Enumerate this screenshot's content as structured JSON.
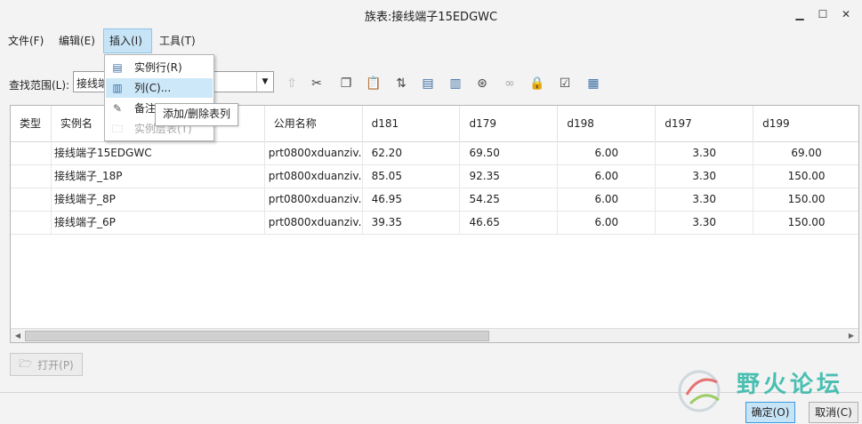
{
  "window": {
    "title": "族表:接线端子15EDGWC"
  },
  "menus": [
    {
      "label": "文件(F)"
    },
    {
      "label": "编辑(E)"
    },
    {
      "label": "插入(I)"
    },
    {
      "label": "工具(T)"
    }
  ],
  "insert_menu": {
    "items": [
      {
        "label": "实例行(R)",
        "icon": "instance-row-icon"
      },
      {
        "label": "列(C)...",
        "icon": "column-icon"
      },
      {
        "label": "备注",
        "icon": "note-icon"
      },
      {
        "label": "实例层表(T)",
        "icon": "folder-icon"
      }
    ],
    "tooltip": "添加/删除表列"
  },
  "search": {
    "label": "查找范围(L):",
    "value": "接线端"
  },
  "table": {
    "headers": [
      "类型",
      "实例名",
      "公用名称",
      "d181",
      "d179",
      "d198",
      "d197",
      "d199"
    ],
    "rows": [
      [
        "",
        "接线端子15EDGWC",
        "prt0800xduanziv...",
        "62.20",
        "69.50",
        "6.00",
        "3.30",
        "69.00"
      ],
      [
        "",
        "接线端子_18P",
        "prt0800xduanziv...",
        "85.05",
        "92.35",
        "6.00",
        "3.30",
        "150.00"
      ],
      [
        "",
        "接线端子_8P",
        "prt0800xduanziv...",
        "46.95",
        "54.25",
        "6.00",
        "3.30",
        "150.00"
      ],
      [
        "",
        "接线端子_6P",
        "prt0800xduanziv...",
        "39.35",
        "46.65",
        "6.00",
        "3.30",
        "150.00"
      ]
    ]
  },
  "buttons": {
    "open": "打开(P)",
    "ok": "确定(O)",
    "cancel": "取消(C)"
  },
  "watermark": {
    "text": "野火论坛"
  },
  "colors": {
    "accent": "#c7e4f7",
    "accent_border": "#3c9ae0",
    "watermark": "#2db6a6"
  }
}
